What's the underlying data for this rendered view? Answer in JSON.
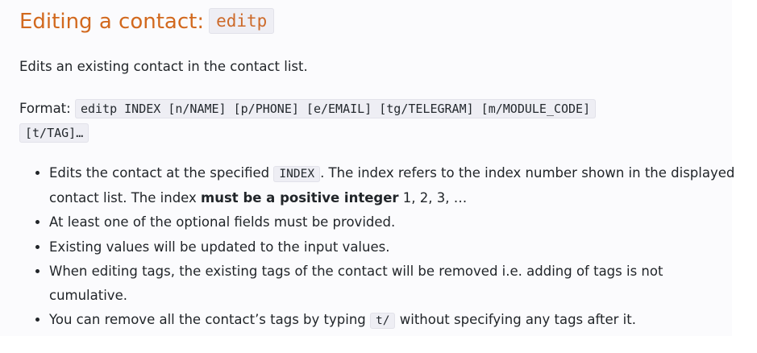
{
  "heading": {
    "text": "Editing a contact:",
    "command": "editp"
  },
  "description": "Edits an existing contact in the contact list.",
  "format": {
    "label": "Format:",
    "syntax_line1": "editp INDEX [n/NAME] [p/PHONE] [e/EMAIL] [tg/TELEGRAM] [m/MODULE_CODE]",
    "syntax_line2": "[t/TAG]…"
  },
  "bullets": {
    "b1": {
      "before": "Edits the contact at the specified",
      "code": "INDEX",
      "after": ". The index refers to the index number shown in the displayed contact list. The index",
      "bold": "must be a positive integer",
      "tail": "1, 2, 3, …"
    },
    "b2": "At least one of the optional fields must be provided.",
    "b3": "Existing values will be updated to the input values.",
    "b4": "When editing tags, the existing tags of the contact will be removed i.e. adding of tags is not cumulative.",
    "b5": {
      "before": "You can remove all the contact’s tags by typing",
      "code": "t/",
      "after": "without specifying any tags after it."
    }
  },
  "colors": {
    "heading": "#d2691e",
    "code_bg": "#eeeef4",
    "text": "#212529"
  }
}
